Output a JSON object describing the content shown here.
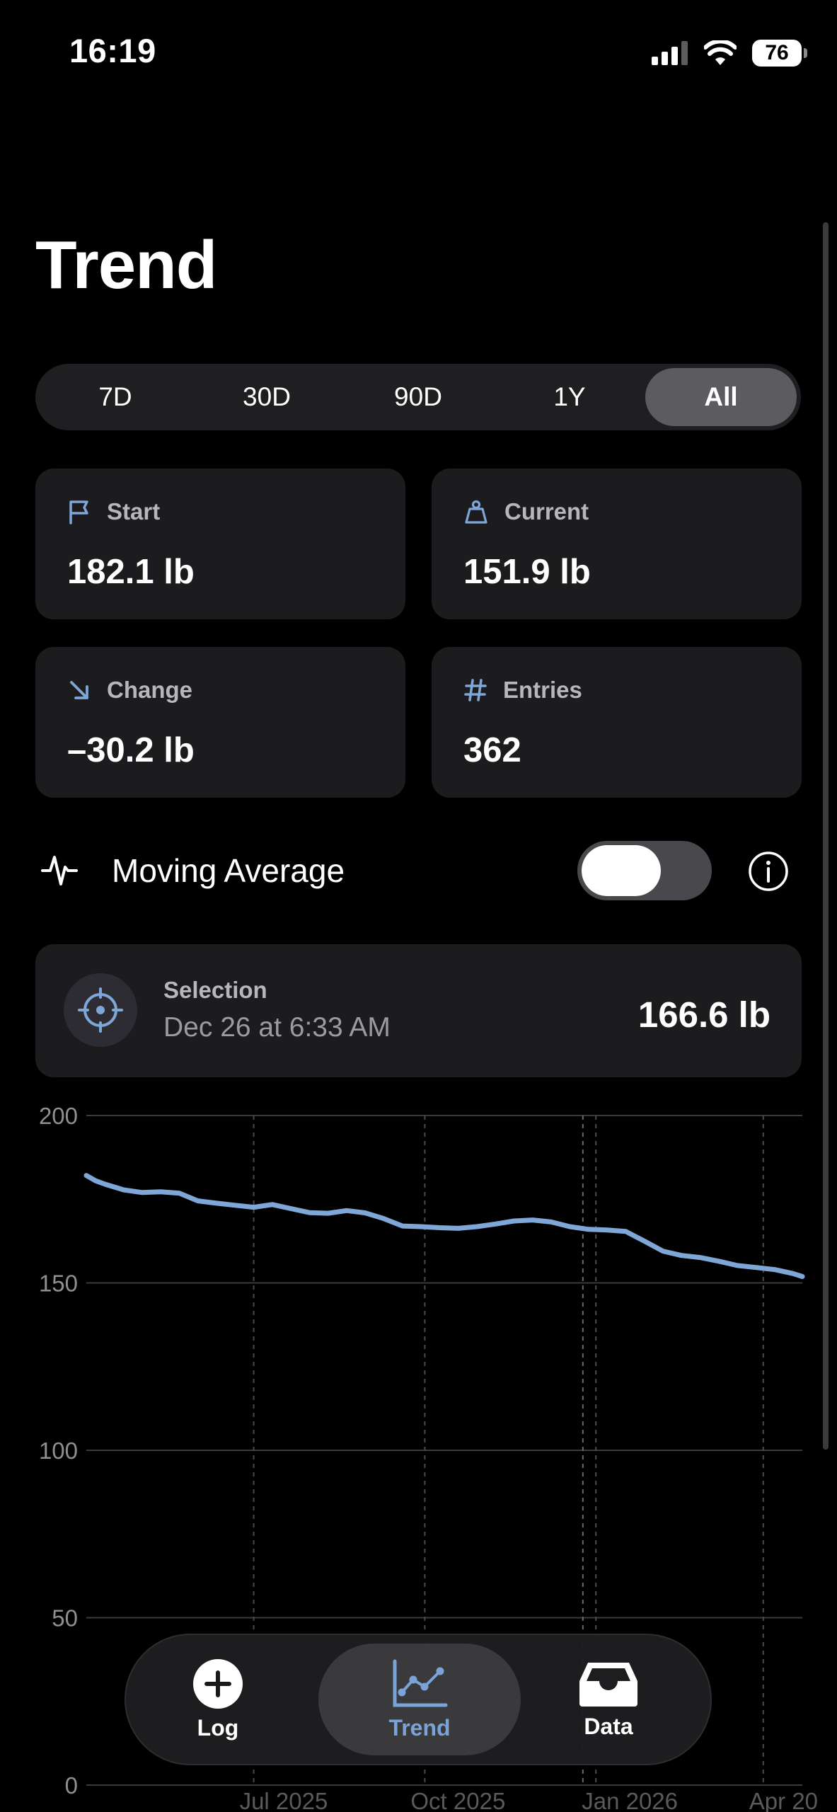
{
  "status_bar": {
    "time": "16:19",
    "battery": "76"
  },
  "page": {
    "title": "Trend"
  },
  "range_tabs": [
    {
      "label": "7D",
      "selected": false
    },
    {
      "label": "30D",
      "selected": false
    },
    {
      "label": "90D",
      "selected": false
    },
    {
      "label": "1Y",
      "selected": false
    },
    {
      "label": "All",
      "selected": true
    }
  ],
  "stats": {
    "start": {
      "label": "Start",
      "value": "182.1 lb",
      "icon": "flag-icon"
    },
    "current": {
      "label": "Current",
      "value": "151.9 lb",
      "icon": "scale-weight-icon"
    },
    "change": {
      "label": "Change",
      "value": "–30.2 lb",
      "icon": "arrow-down-right-icon"
    },
    "entries": {
      "label": "Entries",
      "value": "362",
      "icon": "hash-icon"
    }
  },
  "moving_average": {
    "label": "Moving Average",
    "enabled": false
  },
  "selection": {
    "title": "Selection",
    "date": "Dec 26 at 6:33 AM",
    "value": "166.6 lb"
  },
  "chart_data": {
    "type": "line",
    "y_ticks": [
      "200",
      "150",
      "100",
      "50",
      "0"
    ],
    "ylim": [
      0,
      200
    ],
    "x_ticks": [
      "Jul 2025",
      "Oct 2025",
      "Jan 2026",
      "Apr 20"
    ],
    "x_tick_day": [
      90,
      182,
      274,
      364
    ],
    "selected_day": 267,
    "grid": true,
    "line_color": "#7ea7d8",
    "series": [
      {
        "x": [
          0,
          5,
          10,
          20,
          30,
          40,
          50,
          60,
          70,
          80,
          90,
          100,
          110,
          120,
          130,
          140,
          150,
          160,
          170,
          180,
          190,
          200,
          210,
          220,
          230,
          240,
          250,
          260,
          270,
          280,
          290,
          300,
          310,
          320,
          330,
          340,
          350,
          360,
          370,
          380,
          385
        ],
        "y": [
          182.1,
          180.5,
          179.5,
          177.8,
          177.0,
          177.2,
          176.8,
          174.5,
          173.8,
          173.2,
          172.6,
          173.4,
          172.2,
          171.0,
          170.8,
          171.6,
          170.9,
          169.2,
          167.0,
          166.8,
          166.5,
          166.3,
          166.8,
          167.6,
          168.5,
          168.8,
          168.2,
          166.8,
          166.0,
          165.8,
          165.4,
          162.5,
          159.5,
          158.2,
          157.6,
          156.5,
          155.2,
          154.6,
          154.0,
          152.8,
          151.9
        ]
      }
    ]
  },
  "tab_bar": [
    {
      "label": "Log",
      "icon": "plus-circle-icon"
    },
    {
      "label": "Trend",
      "icon": "chart-line-icon",
      "selected": true
    },
    {
      "label": "Data",
      "icon": "tray-icon"
    }
  ]
}
